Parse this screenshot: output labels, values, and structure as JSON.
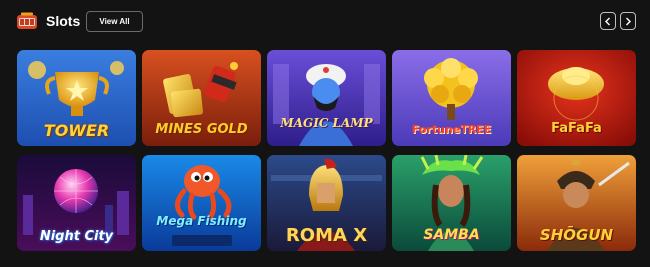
{
  "header": {
    "icon": "slot-machine-icon",
    "title": "Slots",
    "view_all_label": "View All",
    "prev_icon": "chevron-left-icon",
    "next_icon": "chevron-right-icon"
  },
  "games": [
    {
      "label": "TOWER"
    },
    {
      "label": "MINES GOLD"
    },
    {
      "label": "MAGIC LAMP"
    },
    {
      "label": "FortuneTREE"
    },
    {
      "label": "FaFaFa"
    },
    {
      "label": "Night City"
    },
    {
      "label": "Mega Fishing"
    },
    {
      "label": "ROMA X"
    },
    {
      "label": "SAMBA"
    },
    {
      "label": "SHŌGUN"
    }
  ],
  "colors": {
    "background": "#131313",
    "accent": "#f0a021"
  }
}
